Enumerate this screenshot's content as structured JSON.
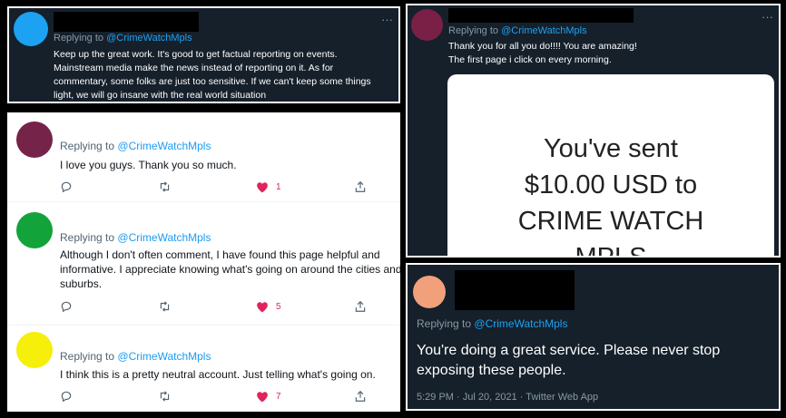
{
  "reply_prefix": "Replying to",
  "handle": "@CrimeWatchMpls",
  "more_glyph": "···",
  "colors": {
    "dark_bg": "#15202b",
    "link": "#1da1f2",
    "like": "#e0245e",
    "muted": "#8899a6"
  },
  "icons": [
    "reply-icon",
    "retweet-icon",
    "heart-icon",
    "share-icon"
  ],
  "tweet1": {
    "avatar_color": "#1da1f2",
    "lines": [
      "Keep up the great work. It's good to get factual reporting on events.",
      "Mainstream media make the news instead of reporting on it.  As for",
      "commentary, some folks are just too sensitive. If we can't keep some things",
      "light, we will go insane with the real world situation"
    ]
  },
  "tweet2": {
    "avatar_color": "#7a2046",
    "lines": [
      "Thank you for all you do!!!!  You are amazing!",
      "The first page i click on every morning."
    ],
    "card_lines": [
      "You've sent",
      "$10.00 USD to",
      "CRIME WATCH",
      "MPLS"
    ]
  },
  "feed": [
    {
      "avatar_color": "#76234a",
      "lines": [
        "I love you guys.  Thank you so much."
      ],
      "likes": "1"
    },
    {
      "avatar_color": "#12a33a",
      "lines": [
        "Although I don't often comment, I have found this page helpful and",
        "informative. I appreciate knowing what's going on around the cities and",
        "suburbs."
      ],
      "likes": "5"
    },
    {
      "avatar_color": "#f5ef0a",
      "lines": [
        "I think this is a pretty neutral account.  Just telling what's going on."
      ],
      "likes": "7"
    }
  ],
  "tweet3": {
    "avatar_color": "#f2a07b",
    "lines": [
      "You're doing a great service. Please never stop",
      "exposing these people."
    ],
    "meta": "5:29 PM · Jul 20, 2021 · Twitter Web App"
  }
}
